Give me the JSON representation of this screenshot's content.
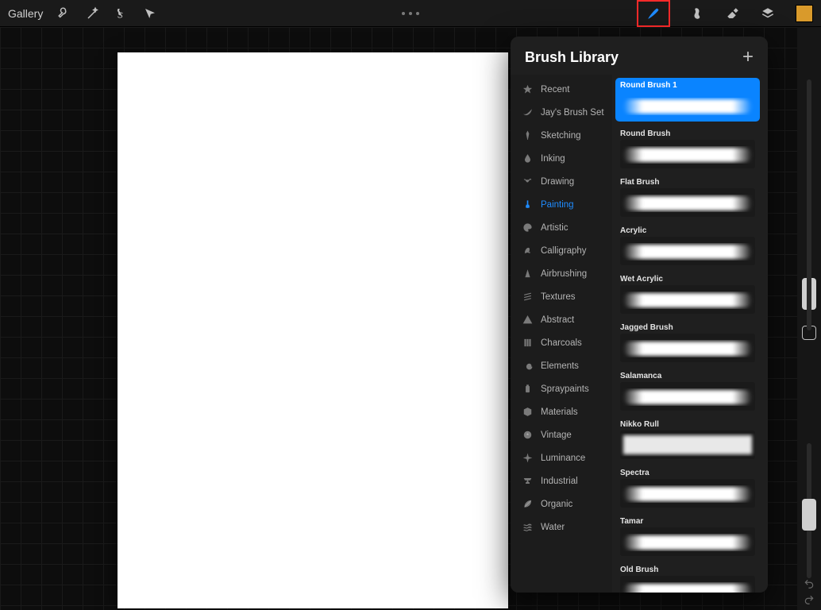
{
  "topbar": {
    "gallery_label": "Gallery"
  },
  "panel": {
    "title": "Brush Library"
  },
  "categories": [
    {
      "label": "Recent",
      "icon": "star"
    },
    {
      "label": "Jay's Brush Set",
      "icon": "swoosh"
    },
    {
      "label": "Sketching",
      "icon": "pencil"
    },
    {
      "label": "Inking",
      "icon": "drop"
    },
    {
      "label": "Drawing",
      "icon": "zig"
    },
    {
      "label": "Painting",
      "icon": "brush",
      "active": true
    },
    {
      "label": "Artistic",
      "icon": "palette"
    },
    {
      "label": "Calligraphy",
      "icon": "script-a"
    },
    {
      "label": "Airbrushing",
      "icon": "spray-cone"
    },
    {
      "label": "Textures",
      "icon": "hatch"
    },
    {
      "label": "Abstract",
      "icon": "triangle"
    },
    {
      "label": "Charcoals",
      "icon": "bars"
    },
    {
      "label": "Elements",
      "icon": "spiral"
    },
    {
      "label": "Spraypaints",
      "icon": "can"
    },
    {
      "label": "Materials",
      "icon": "cube"
    },
    {
      "label": "Vintage",
      "icon": "badge"
    },
    {
      "label": "Luminance",
      "icon": "sparkle"
    },
    {
      "label": "Industrial",
      "icon": "anvil"
    },
    {
      "label": "Organic",
      "icon": "leaf"
    },
    {
      "label": "Water",
      "icon": "waves"
    }
  ],
  "brushes": [
    {
      "name": "Round Brush 1",
      "selected": true,
      "style": "soft"
    },
    {
      "name": "Round Brush",
      "selected": false,
      "style": "round"
    },
    {
      "name": "Flat Brush",
      "selected": false,
      "style": "flat"
    },
    {
      "name": "Acrylic",
      "selected": false,
      "style": "acrylic"
    },
    {
      "name": "Wet Acrylic",
      "selected": false,
      "style": "wet"
    },
    {
      "name": "Jagged Brush",
      "selected": false,
      "style": "jagged"
    },
    {
      "name": "Salamanca",
      "selected": false,
      "style": "block"
    },
    {
      "name": "Nikko Rull",
      "selected": false,
      "style": "grunge"
    },
    {
      "name": "Spectra",
      "selected": false,
      "style": "spectra"
    },
    {
      "name": "Tamar",
      "selected": false,
      "style": "tamar"
    },
    {
      "name": "Old Brush",
      "selected": false,
      "style": "old"
    }
  ],
  "colors": {
    "accent": "#0a84ff",
    "highlight_border": "#ff2a2a",
    "swatch": "#d99a2b"
  }
}
